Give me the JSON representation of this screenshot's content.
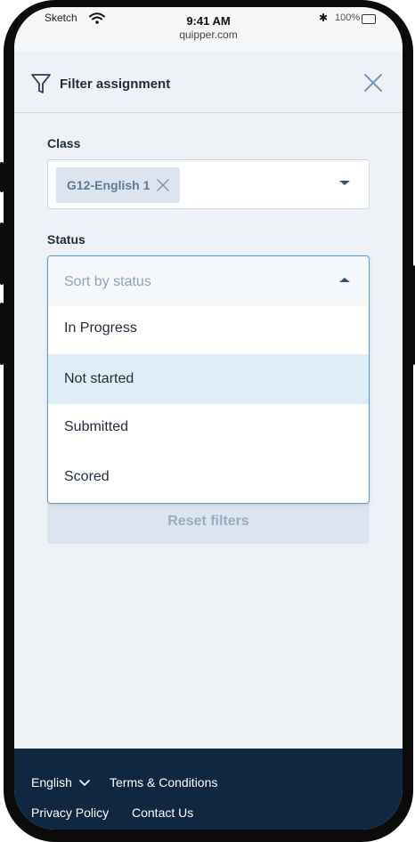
{
  "status_bar": {
    "carrier": "Sketch",
    "time": "9:41 AM",
    "url": "quipper.com",
    "battery": "100%"
  },
  "header": {
    "title": "Filter assignment",
    "filter_icon": "filter-funnel-icon",
    "close_icon": "close-x-icon"
  },
  "class_filter": {
    "label": "Class",
    "selected_chip": "G12-English 1"
  },
  "status_filter": {
    "label": "Status",
    "placeholder": "Sort by status",
    "options": [
      "In Progress",
      "Not started",
      "Submitted",
      "Scored"
    ],
    "highlighted_option": "Not started"
  },
  "reset_label": "Reset filters",
  "footer": {
    "language": "English",
    "terms": "Terms & Conditions",
    "privacy": "Privacy Policy",
    "contact": "Contact Us"
  },
  "colors": {
    "accent_border": "#5a9ec6",
    "highlight": "#ddeef8",
    "footer_bg": "#102741",
    "text_dark": "#1e2c3d"
  }
}
